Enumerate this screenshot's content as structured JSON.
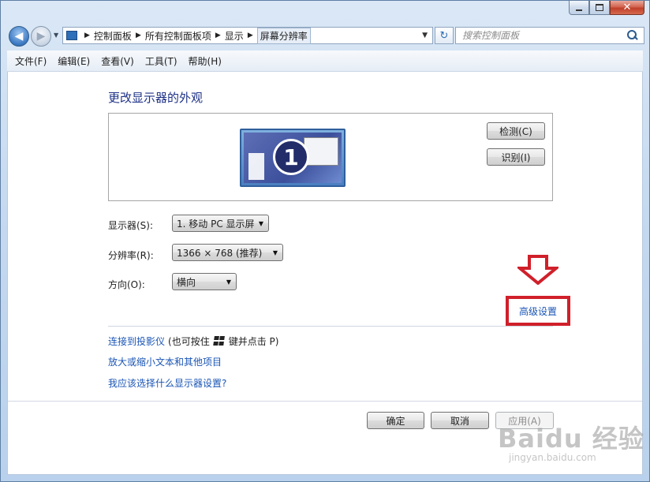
{
  "address_bar": {
    "crumbs": [
      "控制面板",
      "所有控制面板项",
      "显示",
      "屏幕分辨率"
    ]
  },
  "search": {
    "placeholder": "搜索控制面板"
  },
  "menu": [
    "文件(F)",
    "编辑(E)",
    "查看(V)",
    "工具(T)",
    "帮助(H)"
  ],
  "page_title": "更改显示器的外观",
  "monitor": {
    "number": "1"
  },
  "buttons": {
    "detect": "检测(C)",
    "identify": "识别(I)",
    "ok": "确定",
    "cancel": "取消",
    "apply": "应用(A)"
  },
  "fields": {
    "display_label": "显示器(S):",
    "display_value": "1. 移动 PC 显示屏",
    "resolution_label": "分辨率(R):",
    "resolution_value": "1366 × 768 (推荐)",
    "orientation_label": "方向(O):",
    "orientation_value": "横向"
  },
  "advanced_link": "高级设置",
  "links": {
    "projector": "连接到投影仪",
    "projector_hint_pre": "(也可按住",
    "projector_hint_post": "键并点击 P)",
    "text_size": "放大或缩小文本和其他项目",
    "which_settings": "我应该选择什么显示器设置?"
  },
  "watermark": {
    "main": "Baidu 经验",
    "sub": "jingyan.baidu.com"
  },
  "colors": {
    "highlight_red": "#d0202a",
    "link_blue": "#1a55b5",
    "title_blue": "#1e3287"
  }
}
